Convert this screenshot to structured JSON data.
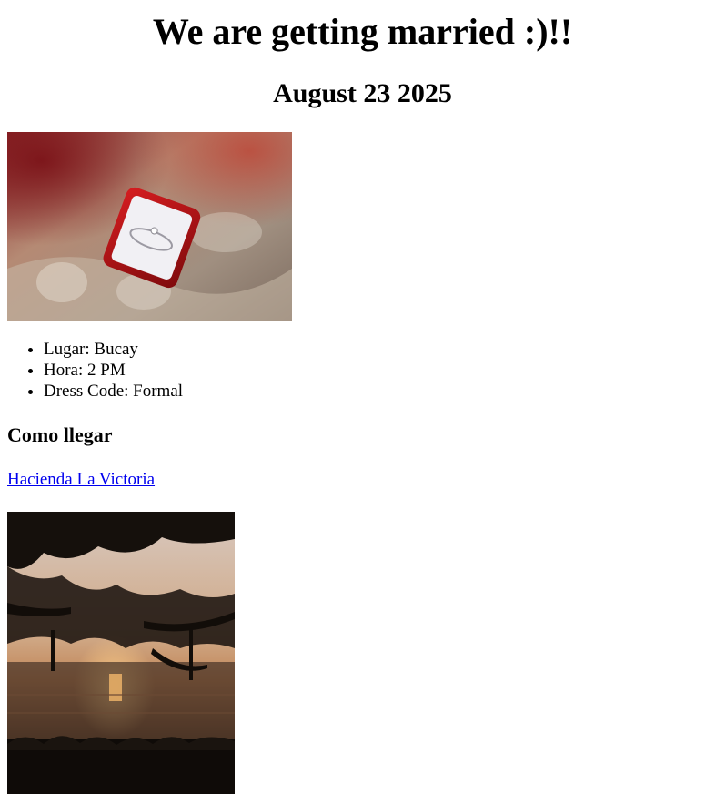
{
  "header": {
    "title": "We are getting married :)!!",
    "date": "August 23 2025"
  },
  "details": {
    "items": [
      "Lugar: Bucay",
      "Hora: 2 PM",
      "Dress Code: Formal"
    ]
  },
  "directions": {
    "heading": "Como llegar",
    "link_label": "Hacienda La Victoria"
  },
  "colors": {
    "link": "#0000EE",
    "ring_box": "#b00f12",
    "sunset_glow": "#e7a049"
  }
}
